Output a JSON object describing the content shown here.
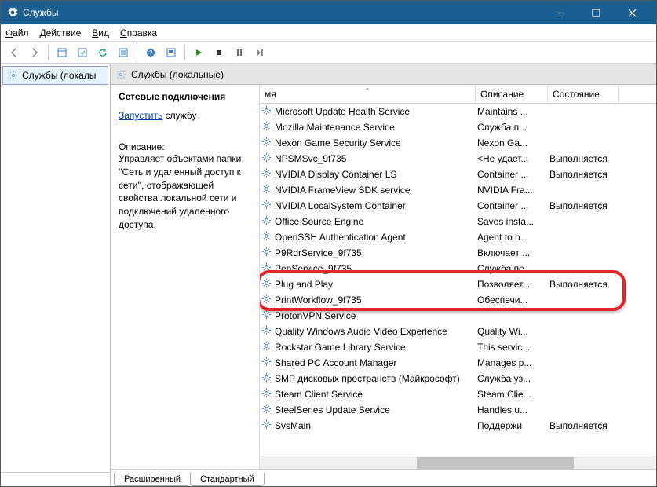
{
  "window": {
    "title": "Службы"
  },
  "menu": {
    "file": "Файл",
    "action": "Действие",
    "view": "Вид",
    "help": "Справка"
  },
  "tree": {
    "item": "Службы (локалы"
  },
  "panel": {
    "title": "Службы (локальные)"
  },
  "detail": {
    "heading": "Сетевые подключения",
    "start_link": "Запустить",
    "start_suffix": " службу",
    "desc_label": "Описание:",
    "desc_text": "Управляет объектами папки ''Сеть и удаленный доступ к сети'', отображающей свойства локальной сети и подключений удаленного доступа."
  },
  "columns": {
    "name": "мя",
    "desc": "Описание",
    "state": "Состояние"
  },
  "services": [
    {
      "name": "Microsoft Update Health Service",
      "desc": "Maintains ...",
      "state": ""
    },
    {
      "name": "Mozilla Maintenance Service",
      "desc": "Служба п...",
      "state": ""
    },
    {
      "name": "Nexon Game Security Service",
      "desc": "Nexon Ga...",
      "state": ""
    },
    {
      "name": "NPSMSvc_9f735",
      "desc": "<Не удает...",
      "state": "Выполняется"
    },
    {
      "name": "NVIDIA Display Container LS",
      "desc": "Container ...",
      "state": "Выполняется"
    },
    {
      "name": "NVIDIA FrameView SDK service",
      "desc": "NVIDIA Fra...",
      "state": ""
    },
    {
      "name": "NVIDIA LocalSystem Container",
      "desc": "Container ...",
      "state": "Выполняется"
    },
    {
      "name": "Office  Source Engine",
      "desc": "Saves insta...",
      "state": ""
    },
    {
      "name": "OpenSSH Authentication Agent",
      "desc": "Agent to h...",
      "state": ""
    },
    {
      "name": "P9RdrService_9f735",
      "desc": "Включает ...",
      "state": ""
    },
    {
      "name": "PenService_9f735",
      "desc": "Служба пе...",
      "state": ""
    },
    {
      "name": "Plug and Play",
      "desc": "Позволяет...",
      "state": "Выполняется"
    },
    {
      "name": "PrintWorkflow_9f735",
      "desc": "Обеспечи...",
      "state": ""
    },
    {
      "name": "ProtonVPN Service",
      "desc": "",
      "state": ""
    },
    {
      "name": "Quality Windows Audio Video Experience",
      "desc": "Quality Wi...",
      "state": ""
    },
    {
      "name": "Rockstar Game Library Service",
      "desc": "This servic...",
      "state": ""
    },
    {
      "name": "Shared PC Account Manager",
      "desc": "Manages p...",
      "state": ""
    },
    {
      "name": "SMP дисковых пространств (Майкрософт)",
      "desc": "Служба уз...",
      "state": ""
    },
    {
      "name": "Steam Client Service",
      "desc": "Steam Clie...",
      "state": ""
    },
    {
      "name": "SteelSeries Update Service",
      "desc": "Handles u...",
      "state": ""
    },
    {
      "name": "SvsMain",
      "desc": "Поддержи",
      "state": "Выполняется"
    }
  ],
  "tabs": {
    "extended": "Расширенный",
    "standard": "Стандартный"
  }
}
